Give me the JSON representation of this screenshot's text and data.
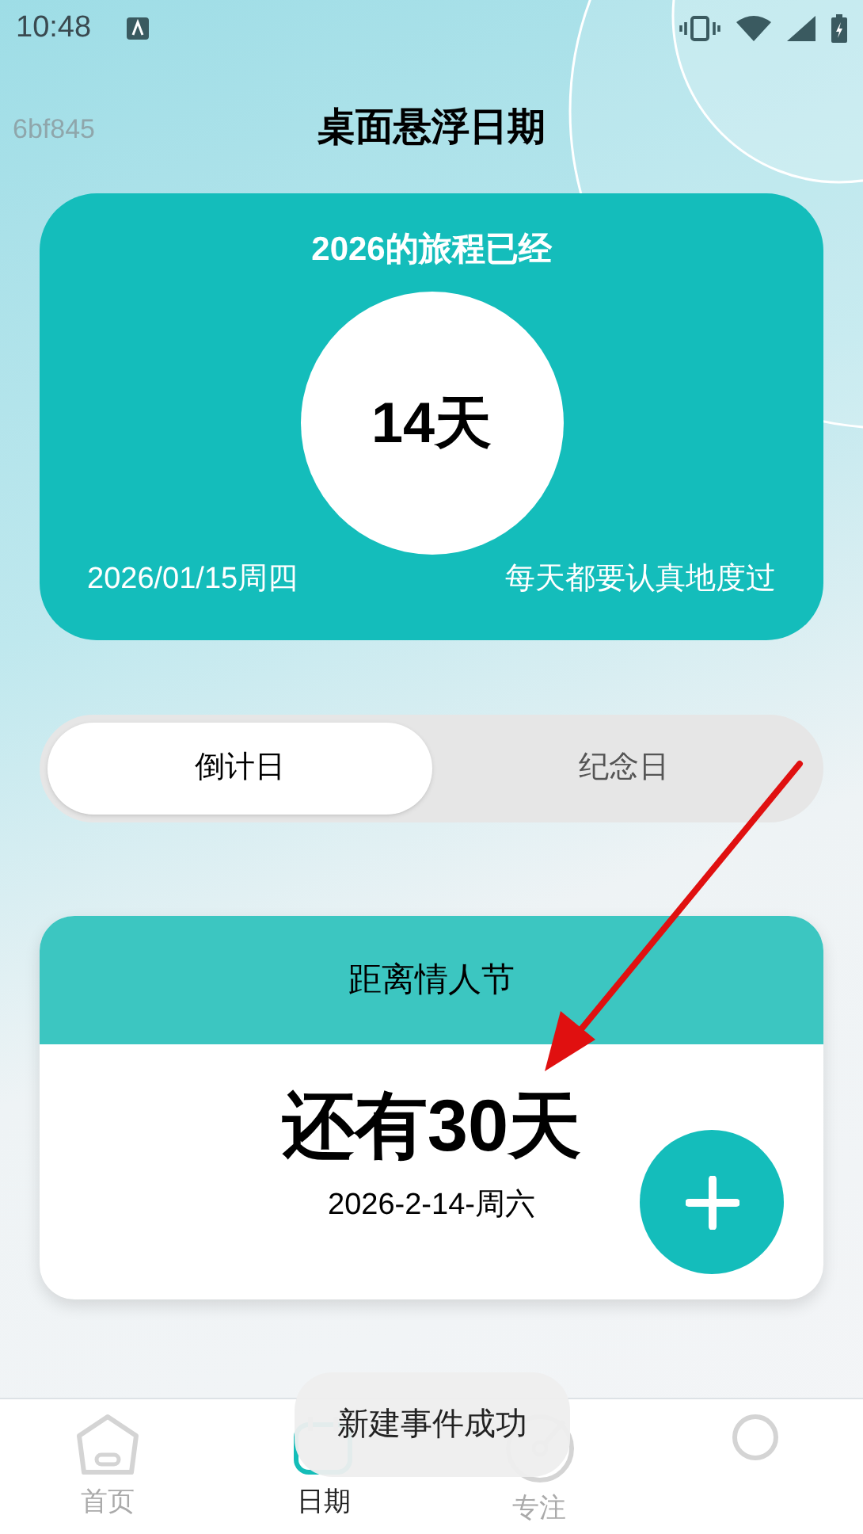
{
  "status_bar": {
    "time": "10:48"
  },
  "debug_label": "6bf845",
  "title": "桌面悬浮日期",
  "year_card": {
    "heading": "2026的旅程已经",
    "days": "14天",
    "date": "2026/01/15周四",
    "motto": "每天都要认真地度过"
  },
  "segments": [
    {
      "label": "倒计日",
      "selected": true
    },
    {
      "label": "纪念日",
      "selected": false
    }
  ],
  "event_card": {
    "title": "距离情人节",
    "countdown": "还有30天",
    "date": "2026-2-14-周六"
  },
  "toast": "新建事件成功",
  "nav": [
    {
      "kind": "home",
      "label": "首页",
      "selected": false
    },
    {
      "kind": "calendar",
      "label": "日期",
      "selected": true
    },
    {
      "kind": "focus",
      "label": "专注",
      "selected": false
    },
    {
      "kind": "profile",
      "selected": false
    }
  ]
}
